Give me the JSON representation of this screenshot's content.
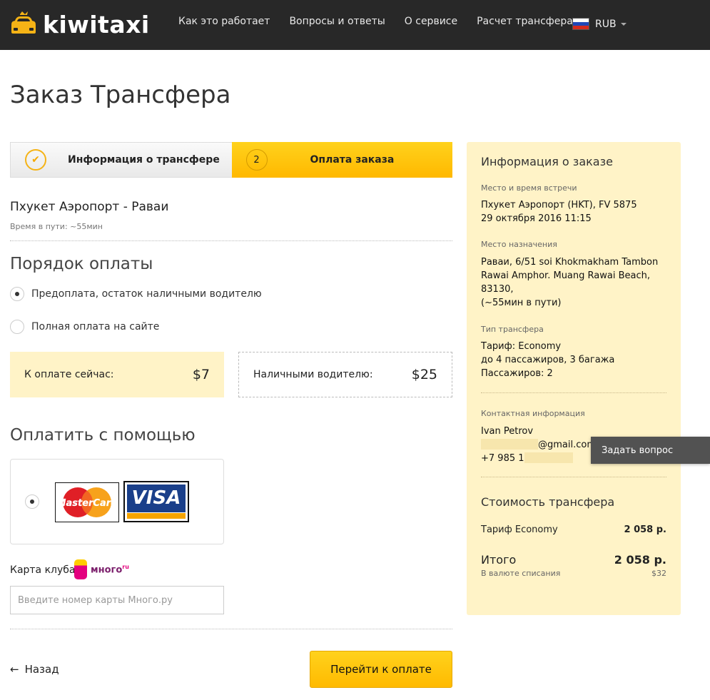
{
  "brand": {
    "name": "kiwitaxi",
    "accent": "#ffc107",
    "header_bg": "#282828"
  },
  "nav": [
    {
      "label": "Как это работает"
    },
    {
      "label": "Вопросы и ответы"
    },
    {
      "label": "О сервисе"
    },
    {
      "label": "Расчет трансфера"
    }
  ],
  "currency": {
    "code": "RUB",
    "flag_icon": "russia-flag-icon"
  },
  "page_title": "Заказ Трансфера",
  "steps": [
    {
      "label": "Информация о трансфере",
      "state": "done",
      "icon": "check-icon"
    },
    {
      "num": "2",
      "label": "Оплата заказа",
      "state": "active"
    }
  ],
  "route": {
    "title": "Пхукет Аэропорт - Раваи",
    "travel_time": "Время в пути: ~55мин"
  },
  "payment_order": {
    "title": "Порядок оплаты",
    "options": [
      {
        "label": "Предоплата, остаток наличными водителю",
        "selected": true
      },
      {
        "label": "Полная оплата на сайте",
        "selected": false
      }
    ],
    "pay_now": {
      "label": "К оплате сейчас:",
      "amount": "$7"
    },
    "pay_cash": {
      "label": "Наличными водителю:",
      "amount": "$25"
    }
  },
  "pay_with": {
    "title": "Оплатить с помощью",
    "method": {
      "selected": true,
      "logos": [
        "MasterCard",
        "VISA"
      ]
    }
  },
  "club": {
    "label": "Карта клуба",
    "logo_text": "много",
    "logo_suffix": "ru",
    "input_placeholder": "Введите номер карты Много.ру",
    "input_value": ""
  },
  "actions": {
    "back": "Назад",
    "submit": "Перейти к оплате"
  },
  "sidebar": {
    "title": "Информация о заказе",
    "meeting": {
      "label": "Место и время встречи",
      "line1": "Пхукет Аэропорт (HKT), FV 5875",
      "line2": "29 октября 2016 11:15"
    },
    "destination": {
      "label": "Место назначения",
      "line1": "Раваи, 6/51 soi Khokmakham Tambon",
      "line2": "Rawai Amphor. Muang Rawai Beach,",
      "line3": "83130,",
      "line4": "(~55мин в пути)"
    },
    "transfer_type": {
      "label": "Тип трансфера",
      "line1": "Тариф: Economy",
      "line2": "до 4 пассажиров, 3 багажа",
      "line3": "Пассажиров: 2"
    },
    "contact": {
      "label": "Контактная информация",
      "name": "Ivan Petrov",
      "email_suffix": "@gmail.com",
      "phone_prefix": "+7 985 1"
    },
    "cost": {
      "title": "Стоимость трансфера",
      "tariff_label": "Тариф Economy",
      "tariff_value": "2 058 р.",
      "total_label": "Итого",
      "total_value": "2 058 р.",
      "currency_label": "В валюте списания",
      "currency_value": "$32"
    }
  },
  "tooltip": "Задать вопрос"
}
